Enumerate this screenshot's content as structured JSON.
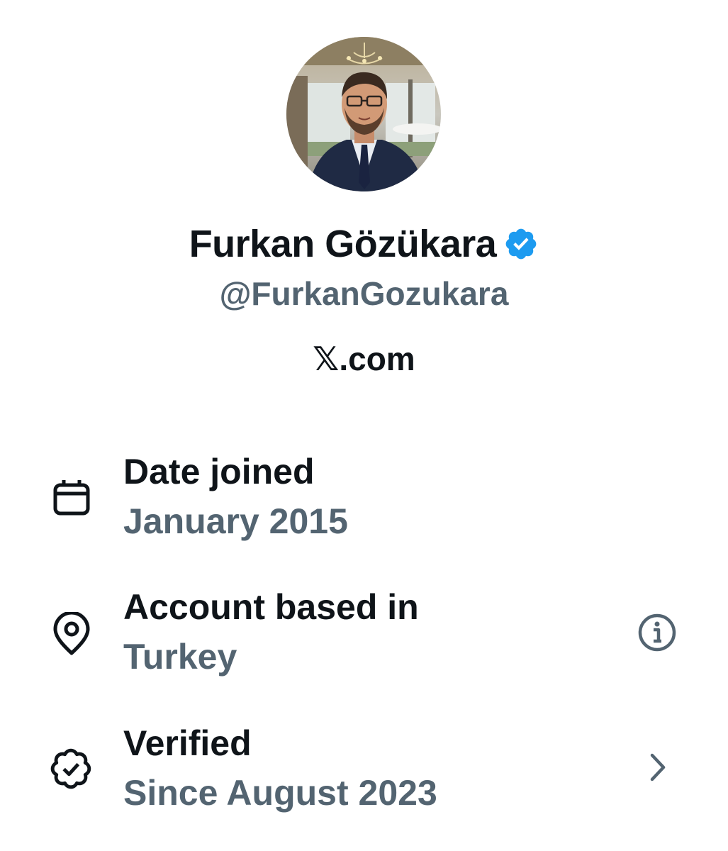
{
  "profile": {
    "display_name": "Furkan Gözükara",
    "handle": "@FurkanGozukara",
    "verified": true,
    "badge_color": "#1d9bf0",
    "site_label": "𝕏.com",
    "avatar_icon": "profile-photo"
  },
  "details": {
    "date_joined": {
      "icon": "calendar-icon",
      "title": "Date joined",
      "value": "January 2015"
    },
    "account_based_in": {
      "icon": "location-pin-icon",
      "title": "Account based in",
      "value": "Turkey",
      "action_icon": "info-icon"
    },
    "verified": {
      "icon": "verified-badge-outline-icon",
      "title": "Verified",
      "value": "Since August 2023",
      "action_icon": "chevron-right-icon"
    }
  },
  "colors": {
    "primary_text": "#0f1419",
    "secondary_text": "#536471",
    "accent": "#1d9bf0",
    "background": "#ffffff"
  }
}
